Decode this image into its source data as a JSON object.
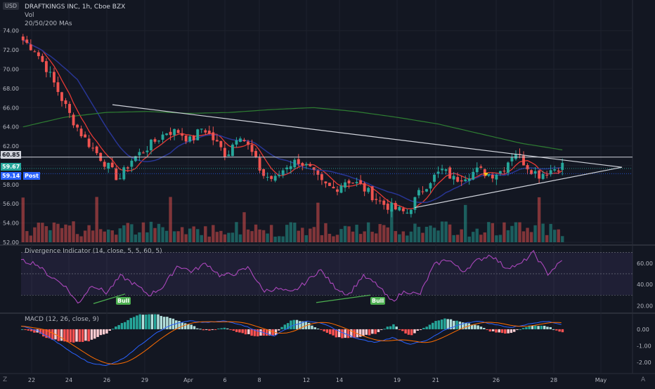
{
  "header": {
    "currency": "USD",
    "title": "DRAFTKINGS INC, 1h, Cboe BZX",
    "vol_label": "Vol",
    "ma_label": "20/50/200 MAs",
    "rsi_label": "Divergence Indicator (14, close, 5, 5, 60, 5)",
    "macd_label": "MACD (12, 26, close, 9)"
  },
  "price_axis": [
    "74.00",
    "72.00",
    "70.00",
    "68.00",
    "66.00",
    "64.00",
    "62.00",
    "60.00",
    "58.00",
    "56.00",
    "54.00",
    "52.00"
  ],
  "price_tags": {
    "level": "60.85",
    "last": "59.67",
    "post_value": "59.14",
    "post_label": "Post"
  },
  "rsi_axis": [
    "60.00",
    "40.00",
    "20.00"
  ],
  "macd_axis": [
    "0.00",
    "-1.00",
    "-2.00"
  ],
  "bull_labels": [
    "Bull",
    "Bull"
  ],
  "time_axis": [
    "22",
    "24",
    "26",
    "29",
    "Apr",
    "6",
    "8",
    "12",
    "14",
    "19",
    "21",
    "26",
    "28",
    "May"
  ],
  "bottom_left": "Z",
  "bottom_right": "A",
  "colors": {
    "bg": "#131722",
    "up": "#26a69a",
    "down": "#ef5350",
    "ma20": "#e53935",
    "ma50": "#283593",
    "ma200": "#2e7d32",
    "rsi": "#ab47bc",
    "macd": "#2962ff",
    "signal": "#ff6d00",
    "bull": "#4caf50"
  },
  "chart_data": [
    {
      "type": "candlestick",
      "title": "DRAFTKINGS INC, 1h, Cboe BZX",
      "ylim": [
        52,
        75
      ],
      "x_ticks": [
        "22",
        "24",
        "26",
        "29",
        "Apr",
        "6",
        "8",
        "12",
        "14",
        "19",
        "21",
        "26",
        "28",
        "May"
      ],
      "close_anchors": [
        73.0,
        72.0,
        70.0,
        67.5,
        65.0,
        63.0,
        61.5,
        60.0,
        58.5,
        60.5,
        61.5,
        62.5,
        63.5,
        63.5,
        62.5,
        64.0,
        62.5,
        61.0,
        63.5,
        61.5,
        59.0,
        58.5,
        60.0,
        60.5,
        59.5,
        58.0,
        57.5,
        58.5,
        58.0,
        57.0,
        56.0,
        55.5,
        55.0,
        57.0,
        58.5,
        59.5,
        58.5,
        59.0,
        59.5,
        59.0,
        59.5,
        61.5,
        60.0,
        59.0,
        59.5,
        60.0
      ],
      "overlays": [
        "MA 20",
        "MA 50",
        "MA 200"
      ],
      "horizontal_levels": [
        60.85
      ],
      "last_price": 59.67,
      "post_price": 59.14
    },
    {
      "type": "bar",
      "title": "Vol",
      "note": "volume histogram, unlabeled scale"
    },
    {
      "type": "line",
      "title": "Divergence Indicator (14, close, 5, 5, 60, 5)",
      "ylim": [
        15,
        75
      ],
      "y_ticks": [
        60,
        40,
        20
      ],
      "anchors": [
        62,
        60,
        48,
        40,
        22,
        40,
        32,
        48,
        40,
        30,
        38,
        58,
        52,
        60,
        48,
        50,
        56,
        34,
        36,
        32,
        42,
        54,
        38,
        30,
        48,
        40,
        24,
        34,
        30,
        58,
        64,
        52,
        62,
        68,
        56,
        58,
        70,
        50,
        62
      ],
      "annotations": [
        "Bull",
        "Bull"
      ]
    },
    {
      "type": "line",
      "title": "MACD (12, 26, close, 9)",
      "ylim": [
        -2.5,
        0.8
      ],
      "y_ticks": [
        0.0,
        -1.0,
        -2.0
      ],
      "macd_anchors": [
        0.2,
        -0.1,
        -0.7,
        -1.4,
        -2.0,
        -2.2,
        -1.8,
        -1.0,
        -0.2,
        0.3,
        0.5,
        0.4,
        0.5,
        0.3,
        -0.1,
        -0.4,
        0.2,
        0.5,
        0.3,
        -0.2,
        -0.6,
        -0.8,
        -0.5,
        -0.9,
        -0.7,
        -0.1,
        0.3,
        0.5,
        0.3,
        0.1,
        0.3,
        0.5,
        0.3
      ],
      "series": [
        {
          "name": "MACD"
        },
        {
          "name": "Signal"
        }
      ]
    }
  ]
}
